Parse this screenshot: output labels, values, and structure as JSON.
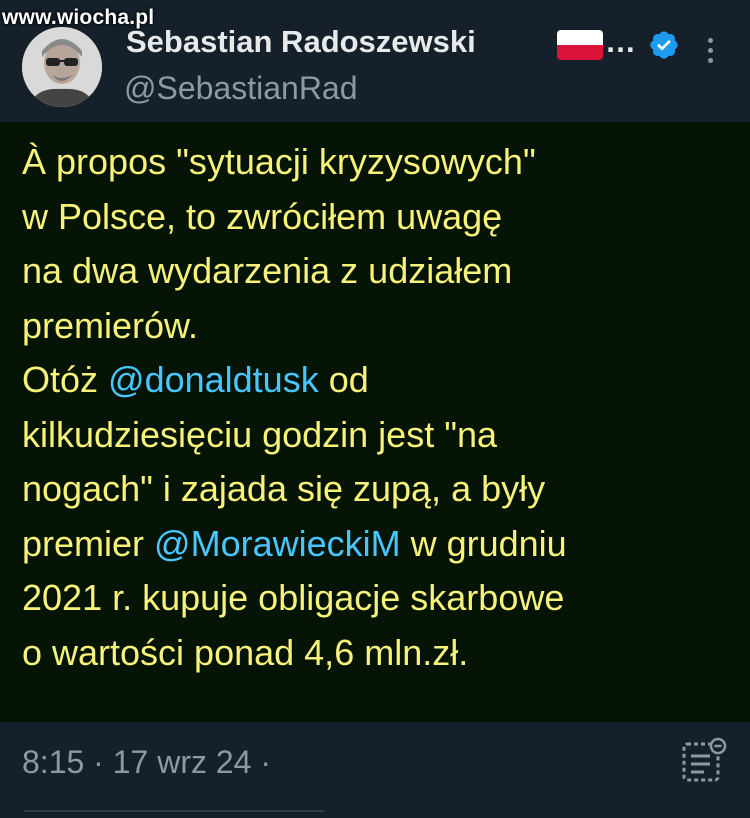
{
  "watermark": "www.wiocha.pl",
  "author": {
    "display_name": "Sebastian Radoszewski",
    "ellipsis": "…",
    "handle": "@SebastianRad",
    "flag_icon": "poland-flag-icon",
    "verified_icon": "verified-badge-icon",
    "verified_color": "#1d9bf0"
  },
  "tweet": {
    "lines": [
      [
        {
          "t": "À propos \"sytuacji kryzysowych\"",
          "m": false
        }
      ],
      [
        {
          "t": "w Polsce, to zwróciłem uwagę",
          "m": false
        }
      ],
      [
        {
          "t": "na dwa wydarzenia z udziałem",
          "m": false
        }
      ],
      [
        {
          "t": "premierów.",
          "m": false
        }
      ],
      [
        {
          "t": "Otóż ",
          "m": false
        },
        {
          "t": "@donaldtusk",
          "m": true
        },
        {
          "t": " od",
          "m": false
        }
      ],
      [
        {
          "t": "kilkudziesięciu godzin jest \"na",
          "m": false
        }
      ],
      [
        {
          "t": "nogach\" i zajada się zupą, a były",
          "m": false
        }
      ],
      [
        {
          "t": "premier ",
          "m": false
        },
        {
          "t": "@MorawieckiM",
          "m": true
        },
        {
          "t": " w grudniu",
          "m": false
        }
      ],
      [
        {
          "t": "2021 r. kupuje obligacje skarbowe",
          "m": false
        }
      ],
      [
        {
          "t": "o wartości ponad 4,6 mln.zł.",
          "m": false
        }
      ]
    ],
    "text_color": "#f7f27a",
    "mention_color": "#49c6ff",
    "background": "#061406"
  },
  "meta": {
    "time": "8:15",
    "separator": "·",
    "date": "17 wrz 24",
    "trailing": "·",
    "views_icon": "post-analytics-icon"
  },
  "menu_icon": "more-options-icon"
}
